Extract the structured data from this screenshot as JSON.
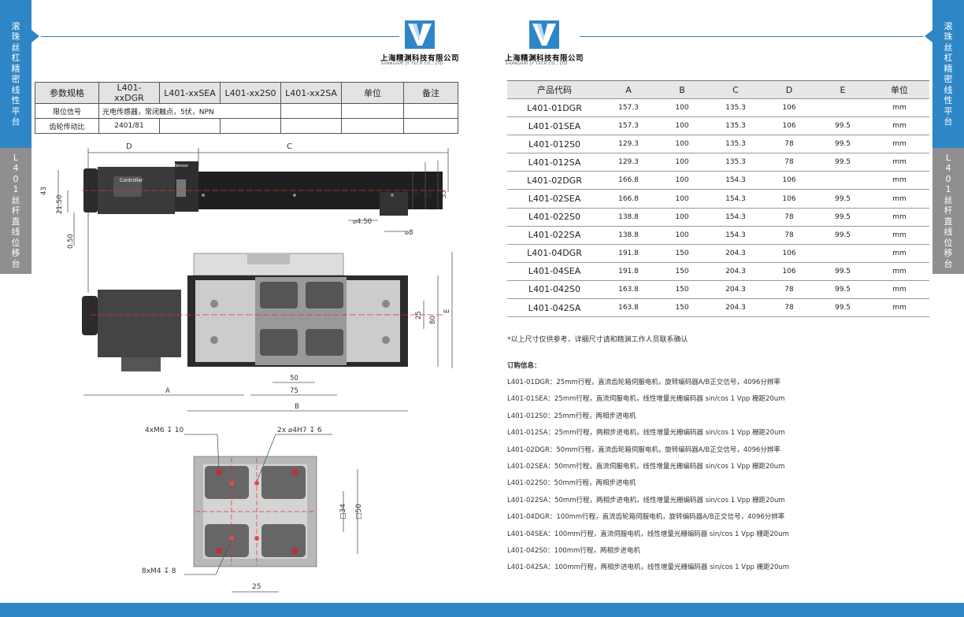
{
  "side_tabs": {
    "left_top": "滚珠丝杠精密线性平台",
    "left_bottom": "L401丝杆直线位移台",
    "right_top": "滚珠丝杠精密线性平台",
    "right_bottom": "L401丝杆直线位移台"
  },
  "brand": {
    "name_cn": "上海精渊科技有限公司",
    "name_en": "SHANGHAI JY TECH CO., LTD"
  },
  "spec_table": {
    "headers": [
      "参数规格",
      "L401-xxDGR",
      "L401-xxSEA",
      "L401-xx2S0",
      "L401-xx2SA",
      "单位",
      "备注"
    ],
    "rows": [
      {
        "label": "限位信号",
        "value": "光电传感器，常闭触点，5伏，NPN"
      },
      {
        "label": "齿轮传动比",
        "value": "2401/81"
      }
    ]
  },
  "dim_table": {
    "headers": [
      "产品代码",
      "A",
      "B",
      "C",
      "D",
      "E",
      "单位"
    ],
    "rows": [
      [
        "L401-01DGR",
        "157.3",
        "100",
        "135.3",
        "106",
        "",
        "mm"
      ],
      [
        "L401-01SEA",
        "157.3",
        "100",
        "135.3",
        "106",
        "99.5",
        "mm"
      ],
      [
        "L401-012S0",
        "129.3",
        "100",
        "135.3",
        "78",
        "99.5",
        "mm"
      ],
      [
        "L401-012SA",
        "129.3",
        "100",
        "135.3",
        "78",
        "99.5",
        "mm"
      ],
      [
        "L401-02DGR",
        "166.8",
        "100",
        "154.3",
        "106",
        "",
        "mm"
      ],
      [
        "L401-02SEA",
        "166.8",
        "100",
        "154.3",
        "106",
        "99.5",
        "mm"
      ],
      [
        "L401-022S0",
        "138.8",
        "100",
        "154.3",
        "78",
        "99.5",
        "mm"
      ],
      [
        "L401-022SA",
        "138.8",
        "100",
        "154.3",
        "78",
        "99.5",
        "mm"
      ],
      [
        "L401-04DGR",
        "191.8",
        "150",
        "204.3",
        "106",
        "",
        "mm"
      ],
      [
        "L401-04SEA",
        "191.8",
        "150",
        "204.3",
        "106",
        "99.5",
        "mm"
      ],
      [
        "L401-042S0",
        "163.8",
        "150",
        "204.3",
        "78",
        "99.5",
        "mm"
      ],
      [
        "L401-042SA",
        "163.8",
        "150",
        "204.3",
        "78",
        "99.5",
        "mm"
      ]
    ]
  },
  "note": "*以上尺寸仅供参考，详细尺寸请和精渊工作人员联系确认",
  "order_info": {
    "title": "订购信息：",
    "items": [
      "L401-01DGR：25mm行程，直流齿轮箱伺服电机，旋转编码器A/B正交信号，4096分辨率",
      "L401-01SEA：25mm行程，直流伺服电机，线性增量光栅编码器 sin/cos 1 Vpp 栅距20um",
      "L401-012S0：25mm行程，两相步进电机",
      "L401-012SA：25mm行程，两相步进电机，线性增量光栅编码器 sin/cos 1 Vpp 栅距20um",
      "L401-02DGR：50mm行程，直流齿轮箱伺服电机，旋转编码器A/B正交信号，4096分辨率",
      "L401-02SEA：50mm行程，直流伺服电机，线性增量光栅编码器 sin/cos 1 Vpp 栅距20um",
      "L401-022S0：50mm行程，两相步进电机",
      "L401-022SA：50mm行程，两相步进电机，线性增量光栅编码器 sin/cos 1 Vpp 栅距20um",
      "L401-04DGR：100mm行程，直流齿轮箱伺服电机，旋转编码器A/B正交信号，4096分辨率",
      "L401-04SEA：100mm行程，直流伺服电机，线性增量光栅编码器 sin/cos 1 Vpp 栅距20um",
      "L401-042S0：100mm行程，两相步进电机",
      "L401-042SA：100mm行程，两相步进电机，线性增量光栅编码器 sin/cos 1 Vpp 栅距20um"
    ]
  },
  "drawing": {
    "side_labels": {
      "D": "D",
      "C": "C",
      "d43": "43",
      "d21": "21.50",
      "d050": "0.50",
      "d8": "8",
      "d34": "34",
      "d35": "35",
      "hole1": "⌀4.50",
      "hole2": "⌀8",
      "controller": "Controller",
      "sensor": "Sensor"
    },
    "top_labels": {
      "d25": "25",
      "d80": "80",
      "E": "E",
      "d50": "50",
      "d75": "75",
      "A": "A",
      "B": "B"
    },
    "bottom_labels": {
      "thread1": "4xM6 ↧ 10",
      "pin": "2x ⌀4H7 ↧ 6",
      "thread2": "8xM4 ↧ 8",
      "sq34": "□34",
      "sq50": "□50",
      "d25": "25"
    }
  },
  "colors": {
    "accent": "#2f86c6",
    "tab_gray": "#8f8f8f",
    "footer": "#2f86c6"
  }
}
